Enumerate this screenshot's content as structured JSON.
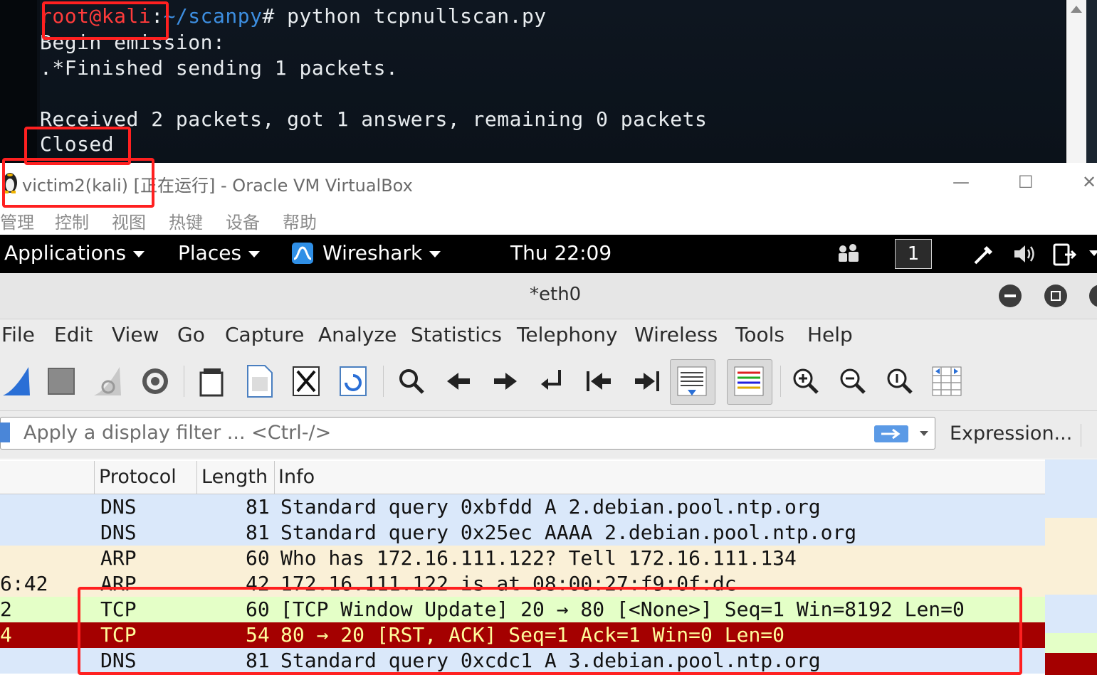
{
  "terminal": {
    "prompt_user": "root@kali",
    "prompt_sep": ":",
    "prompt_path": "~/scanpy",
    "prompt_symbol": "#",
    "command": "python tcpnullscan.py",
    "lines": [
      "Begin emission:",
      ".*Finished sending 1 packets.",
      "Received 2 packets, got 1 answers, remaining 0 packets",
      "Closed"
    ]
  },
  "vbox": {
    "title": "victim2(kali) [正在运行] - Oracle VM VirtualBox",
    "minimize": "—",
    "maximize": "☐",
    "close": "✕",
    "menu": [
      "管理",
      "控制",
      "视图",
      "热键",
      "设备",
      "帮助"
    ]
  },
  "gnome": {
    "applications": "Applications",
    "places": "Places",
    "app": "Wireshark",
    "clock": "Thu 22:09",
    "workspace": "1"
  },
  "wireshark": {
    "title": "*eth0",
    "menu": [
      "File",
      "Edit",
      "View",
      "Go",
      "Capture",
      "Analyze",
      "Statistics",
      "Telephony",
      "Wireless",
      "Tools",
      "Help"
    ],
    "filter_placeholder": "Apply a display filter ... <Ctrl-/>",
    "expression_label": "Expression...",
    "columns": [
      "Protocol",
      "Length",
      "Info"
    ],
    "packets": [
      {
        "left": "",
        "protocol": "DNS",
        "length": "81",
        "info": "Standard query 0xbfdd A 2.debian.pool.ntp.org",
        "bg": "#dae8fa",
        "fg": "#121212"
      },
      {
        "left": "",
        "protocol": "DNS",
        "length": "81",
        "info": "Standard query 0x25ec AAAA 2.debian.pool.ntp.org",
        "bg": "#dae8fa",
        "fg": "#121212"
      },
      {
        "left": "",
        "protocol": "ARP",
        "length": "60",
        "info": "Who has 172.16.111.122? Tell 172.16.111.134",
        "bg": "#faf0d7",
        "fg": "#121212"
      },
      {
        "left": "6:42",
        "protocol": "ARP",
        "length": "42",
        "info": "172.16.111.122 is at 08:00:27:f9:0f:dc",
        "bg": "#faf0d7",
        "fg": "#121212"
      },
      {
        "left": "2",
        "protocol": "TCP",
        "length": "60",
        "info": "[TCP Window Update] 20 → 80 [<None>] Seq=1 Win=8192 Len=0",
        "bg": "#e4ffc7",
        "fg": "#121212"
      },
      {
        "left": "4",
        "protocol": "TCP",
        "length": "54",
        "info": "80 → 20 [RST, ACK] Seq=1 Ack=1 Win=0 Len=0",
        "bg": "#a40000",
        "fg": "#fffc9c"
      },
      {
        "left": "",
        "protocol": "DNS",
        "length": "81",
        "info": "Standard query 0xcdc1 A 3.debian.pool.ntp.org",
        "bg": "#dae8fa",
        "fg": "#121212"
      }
    ]
  },
  "colors": {
    "annotation": "#ff2020",
    "rst_row_bg": "#a40000",
    "rst_row_fg": "#fffc9c"
  }
}
